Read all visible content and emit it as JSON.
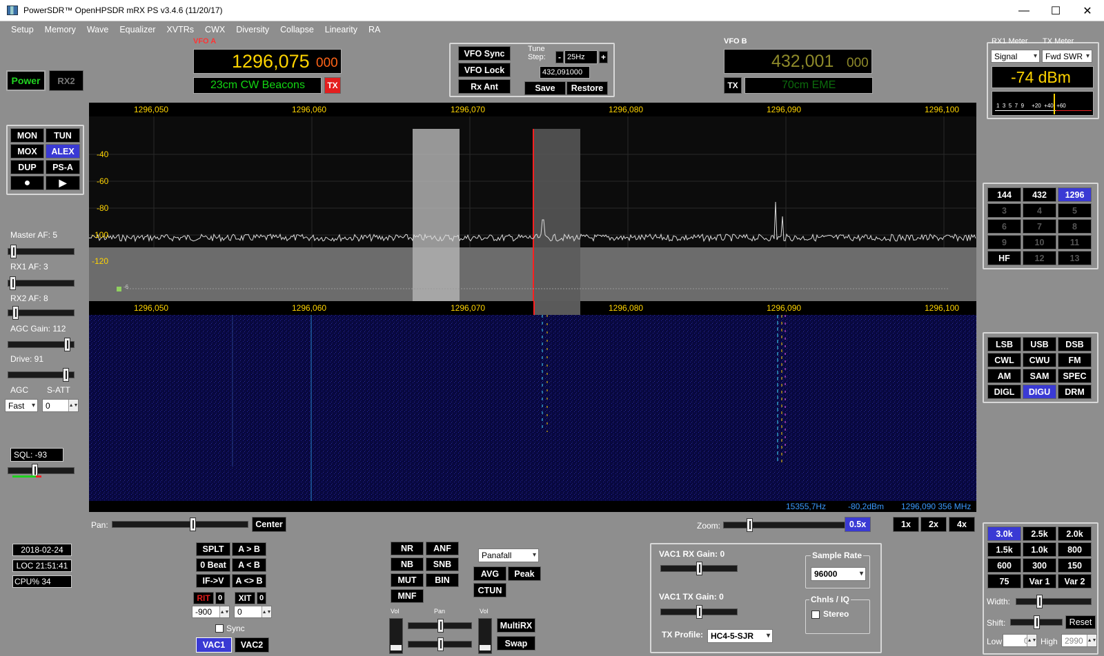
{
  "window": {
    "title": "PowerSDR™ OpenHPSDR mRX PS v3.4.6 (11/20/17)",
    "minimize": "—",
    "maximize": "☐",
    "close": "✕"
  },
  "menu": [
    "Setup",
    "Memory",
    "Wave",
    "Equalizer",
    "XVTRs",
    "CWX",
    "Diversity",
    "Collapse",
    "Linearity",
    "RA"
  ],
  "power": {
    "power": "Power",
    "rx2": "RX2"
  },
  "mode_buttons": {
    "mon": "MON",
    "tun": "TUN",
    "mox": "MOX",
    "alex": "ALEX",
    "dup": "DUP",
    "psa": "PS-A",
    "rec": "●",
    "play": "▶"
  },
  "levels": {
    "master_af": "Master AF:  5",
    "rx1_af": "RX1 AF:  3",
    "rx2_af": "RX2 AF:  8",
    "agc_gain": "AGC Gain:  112",
    "drive": "Drive:  91",
    "agc": "AGC",
    "satt": "S-ATT",
    "agc_value": "Fast",
    "satt_value": "0",
    "sql": "SQL: -93",
    "master_af_level": 0.05,
    "rx1_af_level": 0.03,
    "rx2_af_level": 0.08,
    "agc_gain_level": 0.93,
    "drive_level": 0.91,
    "sql_level": 0.4
  },
  "vfo_a": {
    "label": "VFO A",
    "freq_main": "1296,075",
    "freq_sub": "000",
    "band_text": "23cm CW Beacons",
    "tx": "TX"
  },
  "vfo_b": {
    "label": "VFO B",
    "freq_main": "432,001",
    "freq_sub": "000",
    "band_text": "70cm EME",
    "tx": "TX"
  },
  "vfo_ctrl": {
    "sync": "VFO Sync",
    "lock": "VFO Lock",
    "rxant": "Rx Ant",
    "tune_step_l1": "Tune",
    "tune_step_l2": "Step:",
    "minus": "-",
    "plus": "+",
    "step_value": "25Hz",
    "memory_freq": "432,091000",
    "save": "Save",
    "restore": "Restore"
  },
  "meter": {
    "rx1_label": "RX1 Meter",
    "tx_label": "TX Meter",
    "rx1_mode": "Signal",
    "tx_mode": "Fwd SWR",
    "value": "-74 dBm",
    "scale": "1  3  5  7  9     +20  +40  +60"
  },
  "spectrum": {
    "freq_labels": [
      "1296,050",
      "1296,060",
      "1296,070",
      "1296,080",
      "1296,090",
      "1296,100"
    ],
    "db_labels": [
      "-40",
      "-60",
      "-80",
      "-100",
      "-120"
    ],
    "marker": "-6",
    "status_freq": "15355,7Hz",
    "status_db": "-80,2dBm",
    "status_mhz": "1296,090 356 MHz"
  },
  "bands": [
    "144",
    "432",
    "1296",
    "3",
    "4",
    "5",
    "6",
    "7",
    "8",
    "9",
    "10",
    "11",
    "HF",
    "12",
    "13"
  ],
  "modes": [
    "LSB",
    "USB",
    "DSB",
    "CWL",
    "CWU",
    "FM",
    "AM",
    "SAM",
    "SPEC",
    "DIGL",
    "DIGU",
    "DRM"
  ],
  "filters": [
    "3.0k",
    "2.5k",
    "2.0k",
    "1.5k",
    "1.0k",
    "800",
    "600",
    "300",
    "150",
    "75",
    "Var 1",
    "Var 2"
  ],
  "filter_ctrl": {
    "width": "Width:",
    "shift": "Shift:",
    "reset": "Reset",
    "low": "Low",
    "high": "High",
    "low_value": "0",
    "high_value": "2990",
    "width_level": 0.3,
    "shift_level": 0.5
  },
  "pan": {
    "label": "Pan:",
    "center": "Center",
    "zoom": "Zoom:",
    "zooms": [
      "0.5x",
      "1x",
      "2x",
      "4x"
    ],
    "pan_level": 0.6,
    "zoom_level": 0.18
  },
  "clock": {
    "date": "2018-02-24",
    "time": "LOC 21:51:41",
    "cpu": "CPU%  34"
  },
  "split": {
    "splt": "SPLT",
    "atob": "A > B",
    "zerobeat": "0 Beat",
    "altb": "A < B",
    "ifv": "IF->V",
    "aswap": "A <> B",
    "rit": "RIT",
    "rit_zero": "0",
    "xit": "XIT",
    "xit_zero": "0",
    "rit_value": "-900",
    "xit_value": "0",
    "sync": "Sync",
    "vac1": "VAC1",
    "vac2": "VAC2"
  },
  "dsp": {
    "nr": "NR",
    "anf": "ANF",
    "nb": "NB",
    "snb": "SNB",
    "mut": "MUT",
    "bin": "BIN",
    "mnf": "MNF",
    "display": "Panafall",
    "avg": "AVG",
    "peak": "Peak",
    "ctun": "CTUN",
    "vol": "Vol",
    "pan": "Pan",
    "vol2": "Vol",
    "multirx": "MultiRX",
    "swap": "Swap"
  },
  "vac": {
    "rx_gain": "VAC1  RX Gain:  0",
    "tx_gain": "VAC1  TX Gain:  0",
    "sample_rate": "Sample Rate",
    "sample_value": "96000",
    "chnls": "Chnls / IQ",
    "stereo": "Stereo",
    "tx_profile": "TX Profile:",
    "profile_value": "HC4-5-SJR",
    "rx_gain_level": 0.5,
    "tx_gain_level": 0.5
  }
}
